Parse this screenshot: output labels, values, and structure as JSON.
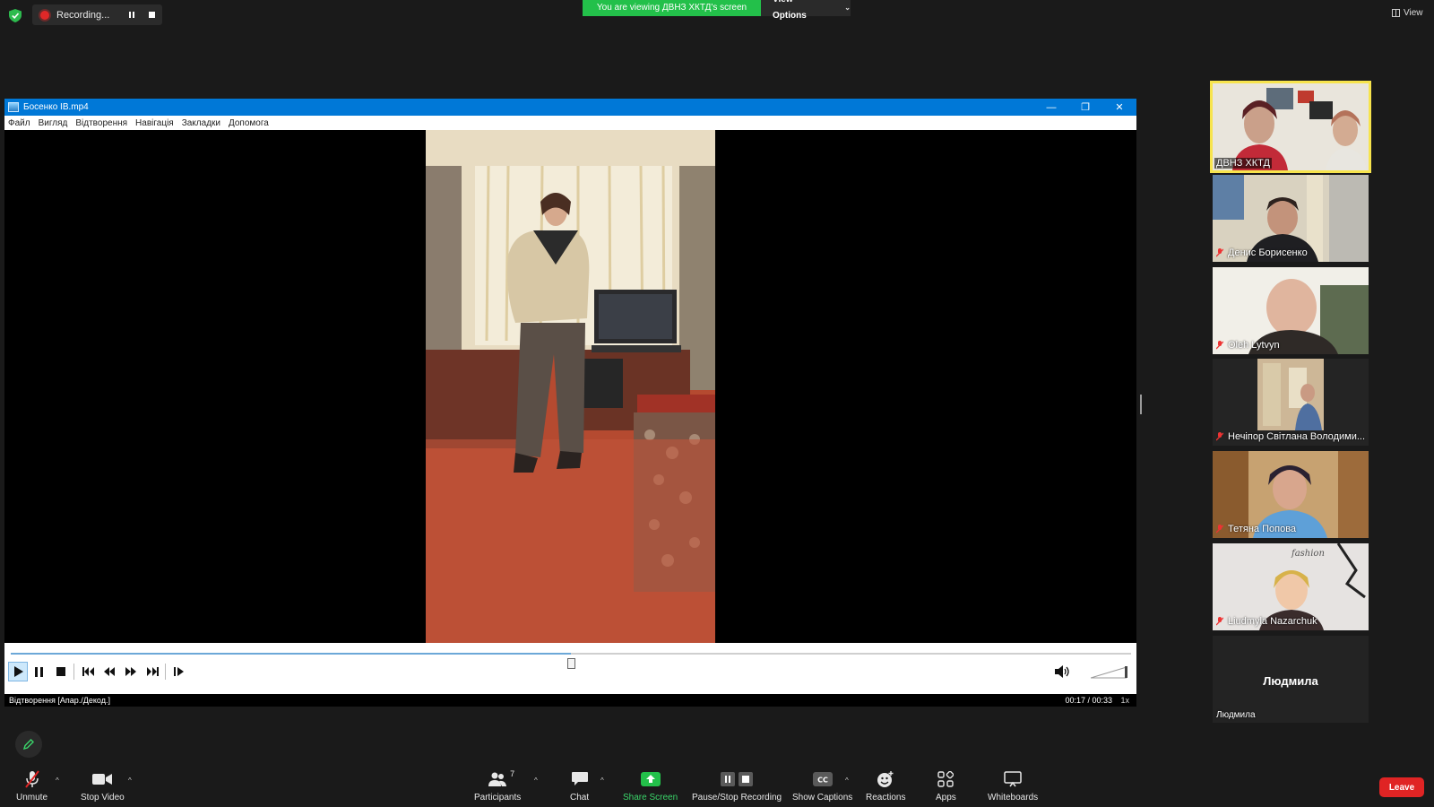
{
  "top_bar": {
    "recording_label": "Recording...",
    "viewing_banner": "You are viewing ДВНЗ ХКТД's screen",
    "view_options_label": "View Options",
    "view_label": "View"
  },
  "player": {
    "title": "Босенко ІВ.mp4",
    "menu": [
      "Файл",
      "Вигляд",
      "Відтворення",
      "Навігація",
      "Закладки",
      "Допомога"
    ],
    "status_left": "Відтворення [Апар./Декод.]",
    "time": "00:17 / 00:33",
    "speed_icon": "1x",
    "progress_fraction": 0.5
  },
  "participants": [
    {
      "name": "ДВНЗ ХКТД",
      "muted": false,
      "active": true
    },
    {
      "name": "Денис Борисенко",
      "muted": true
    },
    {
      "name": "Oleh Lytvyn",
      "muted": true
    },
    {
      "name": "Нечіпор Світлана Володими...",
      "muted": true
    },
    {
      "name": "Тетяна Попова",
      "muted": true
    },
    {
      "name": "Liudmyla Nazarchuk",
      "muted": true
    },
    {
      "name": "Людмила",
      "display_name": "Людмила",
      "muted": false,
      "video": false
    }
  ],
  "toolbar": {
    "unmute": "Unmute",
    "stop_video": "Stop Video",
    "participants": "Participants",
    "participants_count": "7",
    "chat": "Chat",
    "share_screen": "Share Screen",
    "pause_stop_recording": "Pause/Stop Recording",
    "show_captions": "Show Captions",
    "reactions": "Reactions",
    "apps": "Apps",
    "whiteboards": "Whiteboards",
    "leave": "Leave"
  },
  "colors": {
    "accent_green": "#23c04a",
    "leave_red": "#e02424",
    "active_speaker": "#f7e44d",
    "window_title": "#0078d7"
  }
}
